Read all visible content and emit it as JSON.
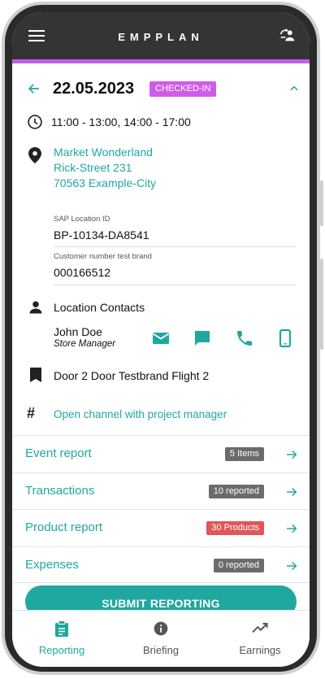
{
  "app": {
    "title": "EMPPLAN"
  },
  "colors": {
    "accent": "#1fa8a0",
    "checked_badge": "#cf5ce8",
    "appbar": "#343434",
    "red_pill": "#e05757"
  },
  "header": {
    "date": "22.05.2023",
    "status_badge": "CHECKED-IN"
  },
  "time": "11:00 - 13:00, 14:00 - 17:00",
  "address": {
    "line1": "Market Wonderland",
    "line2": "Rick-Street 231",
    "line3": "70563 Example-City"
  },
  "fields": [
    {
      "label": "SAP Location ID",
      "value": "BP-10134-DA8541"
    },
    {
      "label": "Customer number test brand",
      "value": "000166512"
    }
  ],
  "contacts": {
    "heading": "Location Contacts",
    "person": {
      "name": "John Doe",
      "role": "Store Manager"
    }
  },
  "brand": "Door 2 Door Testbrand Flight 2",
  "channel_link": "Open channel with project  manager",
  "reports": [
    {
      "label": "Event report",
      "pill": "5 Items",
      "pill_color": "gray"
    },
    {
      "label": "Transactions",
      "pill": "10 reported",
      "pill_color": "gray"
    },
    {
      "label": "Product report",
      "pill": "30 Products",
      "pill_color": "red"
    },
    {
      "label": "Expenses",
      "pill": "0 reported",
      "pill_color": "gray"
    }
  ],
  "submit_label": "SUBMIT REPORTING",
  "bottom_nav": [
    {
      "label": "Reporting",
      "icon": "clipboard-icon",
      "active": true
    },
    {
      "label": "Briefing",
      "icon": "info-icon",
      "active": false
    },
    {
      "label": "Earnings",
      "icon": "trending-up-icon",
      "active": false
    }
  ]
}
